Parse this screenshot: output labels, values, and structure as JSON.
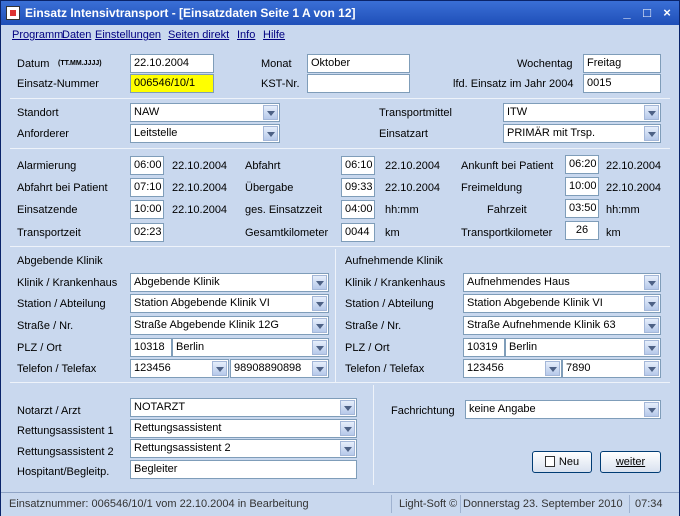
{
  "title": "Einsatz Intensivtransport - [Einsatzdaten Seite 1 A von 12]",
  "menu": [
    "Programm",
    "Daten",
    "Einstellungen",
    "Seiten direkt",
    "Info",
    "Hilfe"
  ],
  "window_controls": {
    "minimize": "_",
    "restore": "□",
    "close": "×"
  },
  "header": {
    "datum_label": "Datum",
    "datum_format": "(TT.MM.JJJJ)",
    "datum": "22.10.2004",
    "monat_label": "Monat",
    "monat": "Oktober",
    "wochentag_label": "Wochentag",
    "wochentag": "Freitag",
    "einsatz_label": "Einsatz-Nummer",
    "einsatz": "006546/10/1",
    "kst_label": "KST-Nr.",
    "kst": "",
    "lfd_label": "lfd. Einsatz im Jahr 2004",
    "lfd": "0015"
  },
  "standort": {
    "standort_label": "Standort",
    "standort": "NAW",
    "anforderer_label": "Anforderer",
    "anforderer": "Leitstelle",
    "transportmittel_label": "Transportmittel",
    "transportmittel": "ITW",
    "einsatzart_label": "Einsatzart",
    "einsatzart": "PRIMÄR mit Trsp."
  },
  "times": {
    "alarmierung_label": "Alarmierung",
    "alarmierung": "06:00",
    "alarmierung_date": "22.10.2004",
    "abfahrt_label": "Abfahrt",
    "abfahrt": "06:10",
    "abfahrt_date": "22.10.2004",
    "ankunft_label": "Ankunft bei Patient",
    "ankunft": "06:20",
    "ankunft_date": "22.10.2004",
    "abfahrt_patient_label": "Abfahrt bei Patient",
    "abfahrt_patient": "07:10",
    "abfahrt_patient_date": "22.10.2004",
    "uebergabe_label": "Übergabe",
    "uebergabe": "09:33",
    "uebergabe_date": "22.10.2004",
    "freimeldung_label": "Freimeldung",
    "freimeldung": "10:00",
    "freimeldung_date": "22.10.2004",
    "einsatzende_label": "Einsatzende",
    "einsatzende": "10:00",
    "einsatzende_date": "22.10.2004",
    "ges_label": "ges. Einsatzzeit",
    "ges": "04:00",
    "ges_unit": "hh:mm",
    "fahrzeit_label": "Fahrzeit",
    "fahrzeit": "03:50",
    "fahrzeit_unit": "hh:mm",
    "transportzeit_label": "Transportzeit",
    "transportzeit": "02:23",
    "gesamtkm_label": "Gesamtkilometer",
    "gesamtkm": "0044",
    "gesamtkm_unit": "km",
    "transportkm_label": "Transportkilometer",
    "transportkm": "26",
    "transportkm_unit": "km"
  },
  "abgebende": {
    "heading": "Abgebende Klinik",
    "klinik_label": "Klinik / Krankenhaus",
    "klinik": "Abgebende Klinik",
    "station_label": "Station / Abteilung",
    "station": "Station Abgebende Klinik VI",
    "strasse_label": "Straße / Nr.",
    "strasse": "Straße Abgebende Klinik 12G",
    "plz_label": "PLZ / Ort",
    "plz": "10318",
    "ort": "Berlin",
    "telefon_label": "Telefon  / Telefax",
    "telefon": "123456",
    "telefax": "98908890898"
  },
  "aufnehmende": {
    "heading": "Aufnehmende Klinik",
    "klinik_label": "Klinik / Krankenhaus",
    "klinik": "Aufnehmendes Haus",
    "station_label": "Station / Abteilung",
    "station": "Station Abgebende Klinik VI",
    "strasse_label": "Straße / Nr.",
    "strasse": "Straße Aufnehmende Klinik 63",
    "plz_label": "PLZ / Ort",
    "plz": "10319",
    "ort": "Berlin",
    "telefon_label": "Telefon  / Telefax",
    "telefon": "123456",
    "telefax": "7890"
  },
  "personal": {
    "notarzt_label": "Notarzt / Arzt",
    "notarzt": "NOTARZT",
    "ra1_label": "Rettungsassistent 1",
    "ra1": "Rettungsassistent",
    "ra2_label": "Rettungsassistent 2",
    "ra2": "Rettungsassistent 2",
    "hospitant_label": "Hospitant/Begleitp.",
    "hospitant": "Begleiter",
    "fachrichtung_label": "Fachrichtung",
    "fachrichtung": "keine Angabe"
  },
  "buttons": {
    "neu": "Neu",
    "weiter": "weiter"
  },
  "status": {
    "message": "Einsatznummer: 006546/10/1 vom 22.10.2004 in Bearbeitung",
    "vendor": "Light-Soft ©",
    "date": "Donnerstag  23. September  2010",
    "time": "07:34"
  }
}
